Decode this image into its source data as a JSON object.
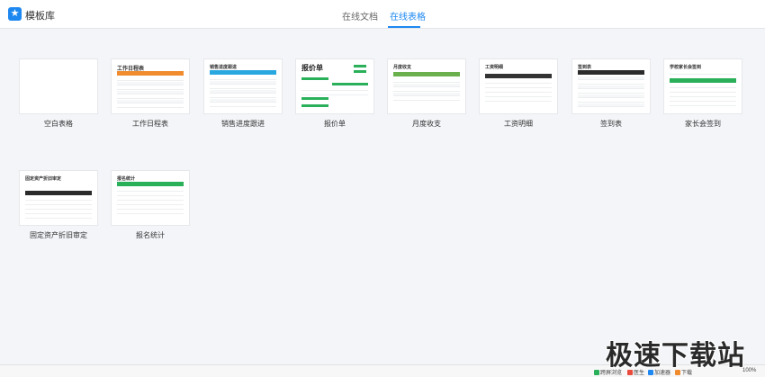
{
  "app": {
    "title": "模板库",
    "logo_glyph": "★",
    "accent": "#1e88f0"
  },
  "tabs": [
    {
      "label": "在线文档",
      "active": false
    },
    {
      "label": "在线表格",
      "active": true
    }
  ],
  "templates": [
    {
      "label": "空白表格",
      "thumb_title": ""
    },
    {
      "label": "工作日程表",
      "thumb_title": "工作日程表"
    },
    {
      "label": "销售进度跟进",
      "thumb_title": "销售进度跟进"
    },
    {
      "label": "报价单",
      "thumb_title": "报价单"
    },
    {
      "label": "月度收支",
      "thumb_title": "月度收支"
    },
    {
      "label": "工资明细",
      "thumb_title": "工资明细"
    },
    {
      "label": "签到表",
      "thumb_title": "签到表"
    },
    {
      "label": "家长会签到",
      "thumb_title": "学校家长会签到"
    },
    {
      "label": "固定资产折旧审定",
      "thumb_title": "固定资产折旧审定"
    },
    {
      "label": "报名统计",
      "thumb_title": "报名统计"
    }
  ],
  "status": {
    "items": [
      "跨屏浏览",
      "医生",
      "加速器",
      "下载",
      "100%"
    ]
  },
  "watermark": "极速下载站"
}
